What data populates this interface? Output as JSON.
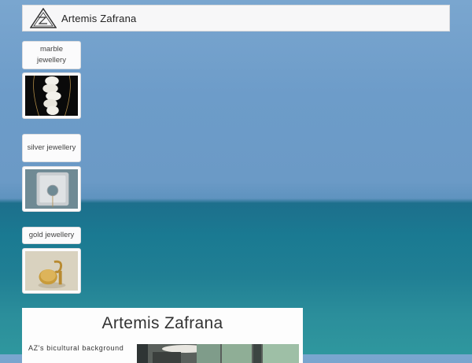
{
  "site": {
    "title": "Artemis Zafrana",
    "logo_icon": "triangle-monogram-icon"
  },
  "categories": [
    {
      "label": "marble jewellery",
      "image": "twisted white marble pendant"
    },
    {
      "label": "silver jewellery",
      "image": "silver ring with round opening"
    },
    {
      "label": "gold jewellery",
      "image": "gold ring on pale background"
    }
  ],
  "intro": {
    "title": "Artemis Zafrana",
    "text": "AZ's bicultural background"
  },
  "colors": {
    "header_bg": "#f7f7f8",
    "card_bg": "#fdfdfd",
    "text": "#333333"
  }
}
